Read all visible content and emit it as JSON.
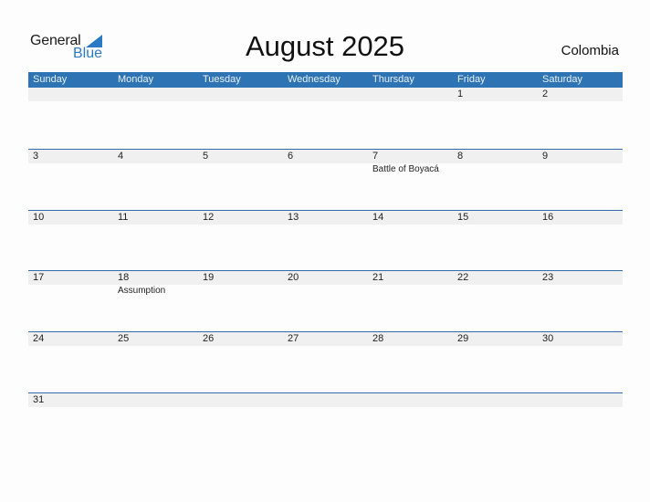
{
  "logo": {
    "line1": "General",
    "line2": "Blue"
  },
  "title": "August 2025",
  "country": "Colombia",
  "colors": {
    "header_bg": "#2e73b3",
    "accent": "#2a7bc4",
    "row_strip": "#f0f0f0"
  },
  "weekdays": [
    "Sunday",
    "Monday",
    "Tuesday",
    "Wednesday",
    "Thursday",
    "Friday",
    "Saturday"
  ],
  "weeks": [
    [
      {
        "day": "",
        "holiday": ""
      },
      {
        "day": "",
        "holiday": ""
      },
      {
        "day": "",
        "holiday": ""
      },
      {
        "day": "",
        "holiday": ""
      },
      {
        "day": "",
        "holiday": ""
      },
      {
        "day": "1",
        "holiday": ""
      },
      {
        "day": "2",
        "holiday": ""
      }
    ],
    [
      {
        "day": "3",
        "holiday": ""
      },
      {
        "day": "4",
        "holiday": ""
      },
      {
        "day": "5",
        "holiday": ""
      },
      {
        "day": "6",
        "holiday": ""
      },
      {
        "day": "7",
        "holiday": "Battle of Boyacá"
      },
      {
        "day": "8",
        "holiday": ""
      },
      {
        "day": "9",
        "holiday": ""
      }
    ],
    [
      {
        "day": "10",
        "holiday": ""
      },
      {
        "day": "11",
        "holiday": ""
      },
      {
        "day": "12",
        "holiday": ""
      },
      {
        "day": "13",
        "holiday": ""
      },
      {
        "day": "14",
        "holiday": ""
      },
      {
        "day": "15",
        "holiday": ""
      },
      {
        "day": "16",
        "holiday": ""
      }
    ],
    [
      {
        "day": "17",
        "holiday": ""
      },
      {
        "day": "18",
        "holiday": "Assumption"
      },
      {
        "day": "19",
        "holiday": ""
      },
      {
        "day": "20",
        "holiday": ""
      },
      {
        "day": "21",
        "holiday": ""
      },
      {
        "day": "22",
        "holiday": ""
      },
      {
        "day": "23",
        "holiday": ""
      }
    ],
    [
      {
        "day": "24",
        "holiday": ""
      },
      {
        "day": "25",
        "holiday": ""
      },
      {
        "day": "26",
        "holiday": ""
      },
      {
        "day": "27",
        "holiday": ""
      },
      {
        "day": "28",
        "holiday": ""
      },
      {
        "day": "29",
        "holiday": ""
      },
      {
        "day": "30",
        "holiday": ""
      }
    ],
    [
      {
        "day": "31",
        "holiday": ""
      },
      {
        "day": "",
        "holiday": ""
      },
      {
        "day": "",
        "holiday": ""
      },
      {
        "day": "",
        "holiday": ""
      },
      {
        "day": "",
        "holiday": ""
      },
      {
        "day": "",
        "holiday": ""
      },
      {
        "day": "",
        "holiday": ""
      }
    ]
  ]
}
